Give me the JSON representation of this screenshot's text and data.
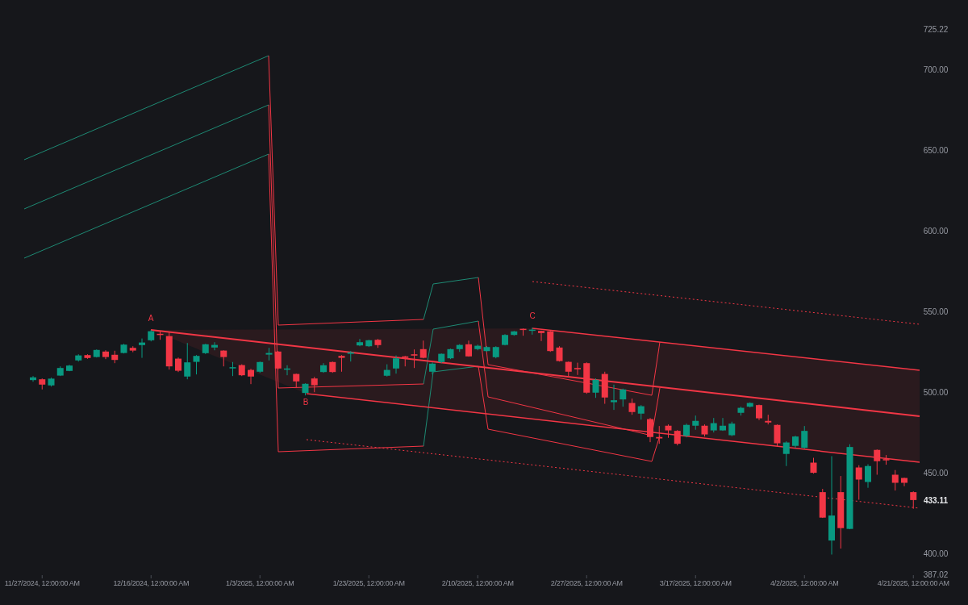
{
  "chart": {
    "chart_data": {
      "type": "candlestick",
      "ylim": [
        387.02,
        725.22
      ],
      "yticks": [
        {
          "value": 387.02,
          "label": "387.02"
        },
        {
          "value": 400,
          "label": "400.00"
        },
        {
          "value": 450,
          "label": "450.00"
        },
        {
          "value": 500,
          "label": "500.00"
        },
        {
          "value": 550,
          "label": "550.00"
        },
        {
          "value": 600,
          "label": "600.00"
        },
        {
          "value": 650,
          "label": "650.00"
        },
        {
          "value": 700,
          "label": "700.00"
        },
        {
          "value": 725.22,
          "label": "725.22"
        }
      ],
      "categories": [
        null,
        "11/27/2024, 12:00:00 AM",
        null,
        null,
        null,
        null,
        null,
        null,
        null,
        null,
        null,
        null,
        null,
        "12/16/2024, 12:00:00 AM",
        null,
        null,
        null,
        null,
        null,
        null,
        null,
        null,
        null,
        null,
        null,
        "1/3/2025, 12:00:00 AM",
        null,
        null,
        null,
        null,
        null,
        null,
        null,
        null,
        null,
        null,
        null,
        "1/23/2025, 12:00:00 AM",
        null,
        null,
        null,
        null,
        null,
        null,
        null,
        null,
        null,
        null,
        null,
        "2/10/2025, 12:00:00 AM",
        null,
        null,
        null,
        null,
        null,
        null,
        null,
        null,
        null,
        null,
        null,
        "2/27/2025, 12:00:00 AM",
        null,
        null,
        null,
        null,
        null,
        null,
        null,
        null,
        null,
        null,
        null,
        "3/17/2025, 12:00:00 AM",
        null,
        null,
        null,
        null,
        null,
        null,
        null,
        null,
        null,
        null,
        null,
        "4/2/2025, 12:00:00 AM",
        null,
        null,
        null,
        null,
        null,
        null,
        null,
        null,
        null,
        null,
        null,
        "4/21/2025, 12:00:00 AM"
      ],
      "ohlc": [
        [
          507.5,
          510,
          506.5,
          509.2
        ],
        [
          508,
          508.5,
          501.7,
          504.7
        ],
        [
          504.2,
          509,
          503.5,
          508.4
        ],
        [
          510.3,
          516,
          510,
          515
        ],
        [
          513.2,
          517,
          513,
          516.5
        ],
        [
          519.7,
          523.5,
          519,
          522.8
        ],
        [
          523,
          523.5,
          520.7,
          521.2
        ],
        [
          521.8,
          526.5,
          521.5,
          526.2
        ],
        [
          525.2,
          526,
          520.5,
          521.8
        ],
        [
          523.2,
          525.7,
          518,
          520
        ],
        [
          524.3,
          530,
          524,
          529.5
        ],
        [
          527.5,
          528.5,
          524.8,
          525.8
        ],
        [
          529.2,
          533.3,
          521.3,
          530.8
        ],
        [
          532.2,
          538.5,
          531.5,
          537.8
        ],
        [
          536.2,
          538,
          532.5,
          535.5
        ],
        [
          534.8,
          537.5,
          514,
          516
        ],
        [
          520.8,
          521.5,
          512.5,
          513.3
        ],
        [
          509.7,
          530.5,
          508,
          518.5
        ],
        [
          518.8,
          523,
          511,
          522.5
        ],
        [
          524.2,
          530,
          523.7,
          529.7
        ],
        [
          527.7,
          531,
          526,
          529.3
        ],
        [
          525.8,
          526,
          516,
          521.8
        ],
        [
          515,
          518.7,
          510,
          515.5
        ],
        [
          516.8,
          517.3,
          510,
          510.5
        ],
        [
          513.8,
          514.5,
          505,
          509.7
        ],
        [
          512.7,
          519,
          512,
          518.7
        ],
        [
          523.3,
          527.5,
          519.7,
          524.3
        ],
        [
          525.2,
          525.5,
          514,
          514.7
        ],
        [
          514.2,
          516.7,
          510.5,
          514.7
        ],
        [
          511.3,
          511.5,
          503,
          506.7
        ],
        [
          499.5,
          505.5,
          498,
          505.2
        ],
        [
          508.5,
          509.5,
          500,
          504.3
        ],
        [
          512.5,
          518,
          512,
          516.7
        ],
        [
          518.7,
          519,
          512,
          512.5
        ],
        [
          522.5,
          523,
          512.7,
          521.3
        ],
        [
          523.8,
          525.5,
          519,
          524.7
        ],
        [
          529,
          533,
          528.5,
          531
        ],
        [
          528.5,
          532.5,
          528,
          532.2
        ],
        [
          532.5,
          533,
          527.5,
          529.2
        ],
        [
          510.2,
          517.3,
          509.7,
          513.8
        ],
        [
          514.7,
          522.8,
          511.5,
          521
        ],
        [
          522.2,
          522.5,
          516,
          521.3
        ],
        [
          523.5,
          526.5,
          515,
          522.7
        ],
        [
          526.7,
          532,
          521,
          521.3
        ],
        [
          512.7,
          518.5,
          511,
          517.7
        ],
        [
          518.7,
          524,
          518,
          523.8
        ],
        [
          521,
          527,
          520.5,
          526.7
        ],
        [
          526.7,
          529.8,
          525,
          529.3
        ],
        [
          529.7,
          532,
          522,
          522.2
        ],
        [
          526.7,
          529.5,
          526,
          528.8
        ],
        [
          525.5,
          528.5,
          525,
          528
        ],
        [
          521.7,
          528.5,
          521,
          528
        ],
        [
          529.3,
          536,
          529,
          535.5
        ],
        [
          535.5,
          538,
          535,
          537.7
        ],
        [
          539.3,
          539.5,
          535,
          538.8
        ],
        [
          538.3,
          540,
          535.7,
          538.8
        ],
        [
          538,
          538.2,
          531.7,
          536.7
        ],
        [
          537.7,
          538,
          525,
          525.5
        ],
        [
          527.7,
          528.5,
          519,
          519.3
        ],
        [
          518.8,
          519,
          510,
          512.7
        ],
        [
          515,
          518.3,
          510.7,
          514.2
        ],
        [
          518,
          518.5,
          499,
          499.7
        ],
        [
          499.7,
          508.5,
          496.5,
          507.7
        ],
        [
          511.3,
          512.7,
          492.8,
          496.7
        ],
        [
          493.8,
          504.7,
          489,
          495
        ],
        [
          495.5,
          502.2,
          491,
          501.7
        ],
        [
          493.3,
          496,
          486,
          487.7
        ],
        [
          486.7,
          492,
          483,
          491.3
        ],
        [
          483.3,
          484,
          469,
          472.2
        ],
        [
          472.2,
          479,
          468,
          471.3
        ],
        [
          479.2,
          480,
          471.7,
          476.3
        ],
        [
          476,
          476.5,
          467,
          468
        ],
        [
          473,
          480.5,
          472,
          479.7
        ],
        [
          479.2,
          485.5,
          476.7,
          482.2
        ],
        [
          479.2,
          480,
          472.5,
          473.8
        ],
        [
          476.3,
          484,
          475,
          480.8
        ],
        [
          476.3,
          484,
          476,
          479.2
        ],
        [
          473.3,
          481.7,
          472.7,
          480.5
        ],
        [
          487.2,
          491,
          485.5,
          490.3
        ],
        [
          491,
          493.7,
          490.5,
          493.3
        ],
        [
          492,
          492.3,
          482.7,
          483.8
        ],
        [
          482.2,
          486,
          480,
          481.2
        ],
        [
          479.7,
          480,
          466.3,
          468.3
        ],
        [
          461.7,
          469.5,
          454.2,
          468.8
        ],
        [
          466.7,
          473,
          465.5,
          472.5
        ],
        [
          465.5,
          479,
          465,
          476
        ],
        [
          456.3,
          459.3,
          449.5,
          450
        ],
        [
          438,
          440,
          422,
          422.2
        ],
        [
          408,
          460.3,
          399.3,
          423.5
        ],
        [
          438,
          448,
          403,
          415.7
        ],
        [
          415.2,
          467.7,
          415,
          466
        ],
        [
          453.3,
          454.7,
          433.3,
          445.8
        ],
        [
          444.3,
          455.3,
          440.7,
          454.2
        ],
        [
          464.2,
          464.5,
          448.8,
          457.2
        ],
        [
          458.5,
          461,
          455,
          457.7
        ],
        [
          448.8,
          451.7,
          439,
          443.8
        ],
        [
          446.8,
          447,
          441.7,
          443.8
        ],
        [
          438,
          438.5,
          427.7,
          433.1
        ]
      ],
      "annotations": [
        {
          "text": "A"
        },
        {
          "text": "B"
        },
        {
          "text": "C"
        }
      ]
    },
    "last_price": "433.11"
  }
}
